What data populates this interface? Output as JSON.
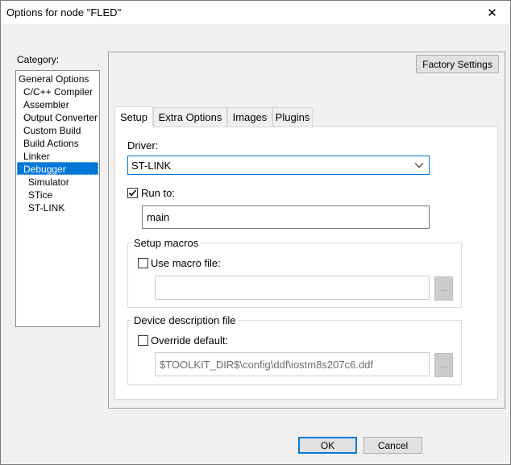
{
  "window": {
    "title": "Options for node \"FLED\"",
    "close_glyph": "✕"
  },
  "category": {
    "label": "Category:",
    "items": [
      {
        "label": "General Options",
        "selected": false,
        "level": 0
      },
      {
        "label": "C/C++ Compiler",
        "selected": false,
        "level": 1
      },
      {
        "label": "Assembler",
        "selected": false,
        "level": 1
      },
      {
        "label": "Output Converter",
        "selected": false,
        "level": 1
      },
      {
        "label": "Custom Build",
        "selected": false,
        "level": 1
      },
      {
        "label": "Build Actions",
        "selected": false,
        "level": 1
      },
      {
        "label": "Linker",
        "selected": false,
        "level": 1
      },
      {
        "label": "Debugger",
        "selected": true,
        "level": 1
      },
      {
        "label": "Simulator",
        "selected": false,
        "level": 2
      },
      {
        "label": "STice",
        "selected": false,
        "level": 2
      },
      {
        "label": "ST-LINK",
        "selected": false,
        "level": 2
      }
    ]
  },
  "factory_settings_label": "Factory Settings",
  "tabs": [
    {
      "label": "Setup",
      "active": true
    },
    {
      "label": "Extra Options",
      "active": false
    },
    {
      "label": "Images",
      "active": false
    },
    {
      "label": "Plugins",
      "active": false
    }
  ],
  "setup": {
    "driver_label": "Driver:",
    "driver_value": "ST-LINK",
    "run_to": {
      "label": "Run to:",
      "checked": true,
      "value": "main"
    },
    "setup_macros": {
      "title": "Setup macros",
      "use_macro_label": "Use macro file:",
      "checked": false,
      "value": "",
      "browse_label": "..."
    },
    "device_description": {
      "title": "Device description file",
      "override_label": "Override default:",
      "checked": false,
      "value": "$TOOLKIT_DIR$\\config\\ddf\\iostm8s207c6.ddf",
      "browse_label": "..."
    }
  },
  "buttons": {
    "ok": "OK",
    "cancel": "Cancel"
  },
  "colors": {
    "selection": "#0078d7",
    "focus_border": "#0078d7"
  }
}
